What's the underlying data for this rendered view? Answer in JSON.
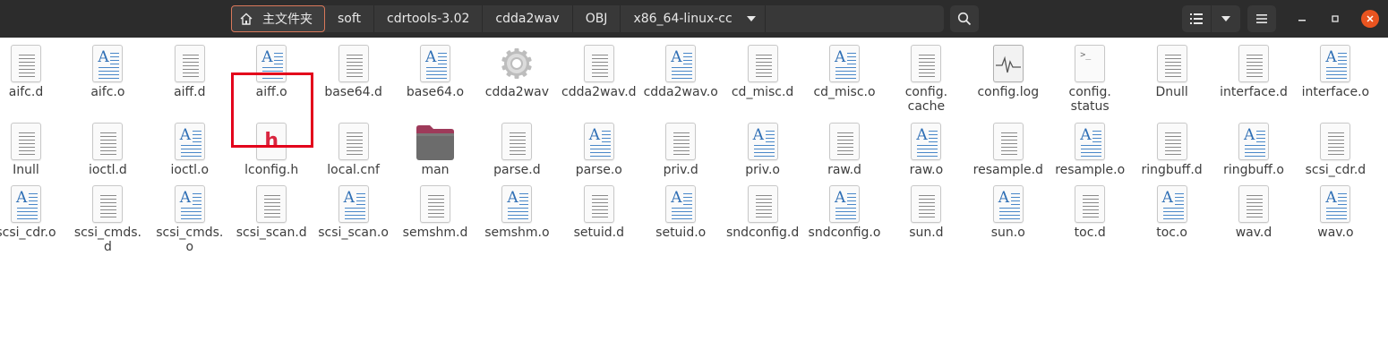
{
  "headerbar": {
    "breadcrumbs": [
      {
        "label": "主文件夹",
        "icon": "home-icon"
      },
      {
        "label": "soft"
      },
      {
        "label": "cdrtools-3.02"
      },
      {
        "label": "cdda2wav"
      },
      {
        "label": "OBJ"
      },
      {
        "label": "x86_64-linux-cc"
      }
    ],
    "buttons": [
      "search-icon",
      "list-view-icon",
      "view-options-chevron-icon",
      "hamburger-menu-icon",
      "minimize-icon",
      "restore-icon",
      "close-icon"
    ]
  },
  "files": {
    "row1": [
      {
        "label": "aifc.d",
        "type": "text"
      },
      {
        "label": "aifc.o",
        "type": "object"
      },
      {
        "label": "aiff.d",
        "type": "text"
      },
      {
        "label": "aiff.o",
        "type": "object"
      },
      {
        "label": "base64.d",
        "type": "text"
      },
      {
        "label": "base64.o",
        "type": "object"
      },
      {
        "label": "cdda2wav",
        "type": "executable"
      },
      {
        "label": "cdda2wav.d",
        "type": "text"
      },
      {
        "label": "cdda2wav.o",
        "type": "object"
      },
      {
        "label": "cd_misc.d",
        "type": "text"
      },
      {
        "label": "cd_misc.o",
        "type": "object"
      },
      {
        "label": "config.\ncache",
        "type": "text"
      },
      {
        "label": "config.log",
        "type": "log"
      },
      {
        "label": "config.\nstatus",
        "type": "script"
      },
      {
        "label": "Dnull",
        "type": "text"
      },
      {
        "label": "interface.d",
        "type": "text"
      },
      {
        "label": "interface.o",
        "type": "object"
      }
    ],
    "row2": [
      {
        "label": "Inull",
        "type": "text"
      },
      {
        "label": "ioctl.d",
        "type": "text"
      },
      {
        "label": "ioctl.o",
        "type": "object"
      },
      {
        "label": "lconfig.h",
        "type": "header"
      },
      {
        "label": "local.cnf",
        "type": "text"
      },
      {
        "label": "man",
        "type": "folder"
      },
      {
        "label": "parse.d",
        "type": "text"
      },
      {
        "label": "parse.o",
        "type": "object"
      },
      {
        "label": "priv.d",
        "type": "text"
      },
      {
        "label": "priv.o",
        "type": "object"
      },
      {
        "label": "raw.d",
        "type": "text"
      },
      {
        "label": "raw.o",
        "type": "object"
      },
      {
        "label": "resample.d",
        "type": "text"
      },
      {
        "label": "resample.o",
        "type": "object"
      },
      {
        "label": "ringbuff.d",
        "type": "text"
      },
      {
        "label": "ringbuff.o",
        "type": "object"
      },
      {
        "label": "scsi_cdr.d",
        "type": "text"
      }
    ],
    "row3": [
      {
        "label": "scsi_cdr.o",
        "type": "object"
      },
      {
        "label": "scsi_cmds.\nd",
        "type": "text"
      },
      {
        "label": "scsi_cmds.\no",
        "type": "object"
      },
      {
        "label": "scsi_scan.d",
        "type": "text"
      },
      {
        "label": "scsi_scan.o",
        "type": "object"
      },
      {
        "label": "semshm.d",
        "type": "text"
      },
      {
        "label": "semshm.o",
        "type": "object"
      },
      {
        "label": "setuid.d",
        "type": "text"
      },
      {
        "label": "setuid.o",
        "type": "object"
      },
      {
        "label": "sndconfig.d",
        "type": "text"
      },
      {
        "label": "sndconfig.o",
        "type": "object"
      },
      {
        "label": "sun.d",
        "type": "text"
      },
      {
        "label": "sun.o",
        "type": "object"
      },
      {
        "label": "toc.d",
        "type": "text"
      },
      {
        "label": "toc.o",
        "type": "object"
      },
      {
        "label": "wav.d",
        "type": "text"
      },
      {
        "label": "wav.o",
        "type": "object"
      }
    ]
  },
  "highlighted_file": "lconfig.h",
  "colors": {
    "headerbar": "#2c2c2c",
    "accent": "#e95420",
    "highlight": "#e3001b",
    "header_glyph": "#d9263f"
  }
}
